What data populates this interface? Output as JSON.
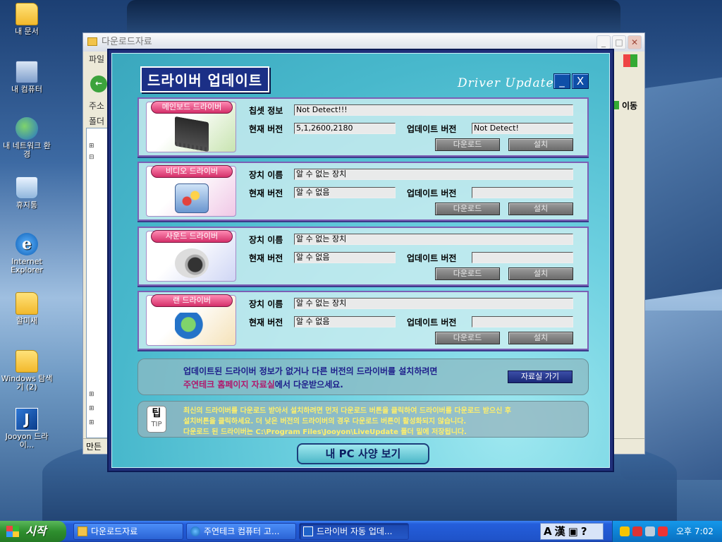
{
  "desktop": {
    "icons": [
      {
        "label": "내 문서",
        "icon": "folder-icon"
      },
      {
        "label": "내 컴퓨터",
        "icon": "computer-icon"
      },
      {
        "label": "내 네트워크 환경",
        "icon": "network-icon"
      },
      {
        "label": "휴지통",
        "icon": "recycle-bin-icon"
      },
      {
        "label": "Internet Explorer",
        "icon": "ie-icon"
      },
      {
        "label": "할미새",
        "icon": "folder-icon"
      },
      {
        "label": "Windows 탐색기 (2)",
        "icon": "explorer-icon"
      },
      {
        "label": "Jooyon 드라이...",
        "icon": "jooyon-icon"
      }
    ]
  },
  "explorer": {
    "title": "다운로드자료",
    "menu_first": "파일",
    "address_label": "주소",
    "folder_label": "폴더",
    "go_label": "이동",
    "status_text": "만든"
  },
  "dialog": {
    "title": "드라이버 업데이트",
    "subtitle": "Driver Update",
    "minimize_label": "_",
    "close_label": "X",
    "download_label": "다운로드",
    "install_label": "설치",
    "panels": [
      {
        "category": "메인보드 드라이버",
        "icon": "chip-icon",
        "name_label": "칩셋 정보",
        "name_value": "Not Detect!!!",
        "current_label": "현재 버전",
        "current_value": "5,1,2600,2180",
        "update_label": "업데이트 버전",
        "update_value": "Not Detect!"
      },
      {
        "category": "비디오 드라이버",
        "icon": "video-palette-icon",
        "name_label": "장치 이름",
        "name_value": "알 수 없는 장치",
        "current_label": "현재 버전",
        "current_value": "알 수 없음",
        "update_label": "업데이트 버전",
        "update_value": ""
      },
      {
        "category": "사운드 드라이버",
        "icon": "speaker-icon",
        "name_label": "장치 이름",
        "name_value": "알 수 없는 장치",
        "current_label": "현재 버전",
        "current_value": "알 수 없음",
        "update_label": "업데이트 버전",
        "update_value": ""
      },
      {
        "category": "랜 드라이버",
        "icon": "globe-network-icon",
        "name_label": "장치 이름",
        "name_value": "알 수 없는 장치",
        "current_label": "현재 버전",
        "current_value": "알 수 없음",
        "update_label": "업데이트 버전",
        "update_value": ""
      }
    ],
    "notice": {
      "line1": "업데이트된 드라이버 정보가 없거나 다른 버전의 드라이버를 설치하려면",
      "line2_highlight": "주연테크 홈페이지 자료실",
      "line2_rest": "에서 다운받으세요.",
      "button": "자료실 가기"
    },
    "tip": {
      "badge_ko": "팁",
      "badge_en": "TIP",
      "lines": [
        "최신의 드라이버를 다운로드 받아서 설치하려면 먼저 다운로드 버튼을 클릭하여 드라이버를 다운로드 받으신 후",
        "설치버튼을 클릭하세요. 더 낮은 버전의 드라이버의 경우 다운로드 버튼이 활성화되지 않습니다.",
        "다운로드 된 드라이버는 C:\\Program Files\\Jooyon\\LiveUpdate 폴더 밑에 저장됩니다."
      ]
    },
    "pc_spec_button": "내 PC 사양 보기"
  },
  "taskbar": {
    "start_label": "시작",
    "tasks": [
      {
        "label": "다운로드자료",
        "icon": "folder-icon"
      },
      {
        "label": "주연테크 컴퓨터 고...",
        "icon": "ie-icon"
      },
      {
        "label": "드라이버 자동 업데...",
        "icon": "jooyon-icon"
      }
    ],
    "ime": [
      "A",
      "漢"
    ],
    "clock": "오후 7:02"
  }
}
